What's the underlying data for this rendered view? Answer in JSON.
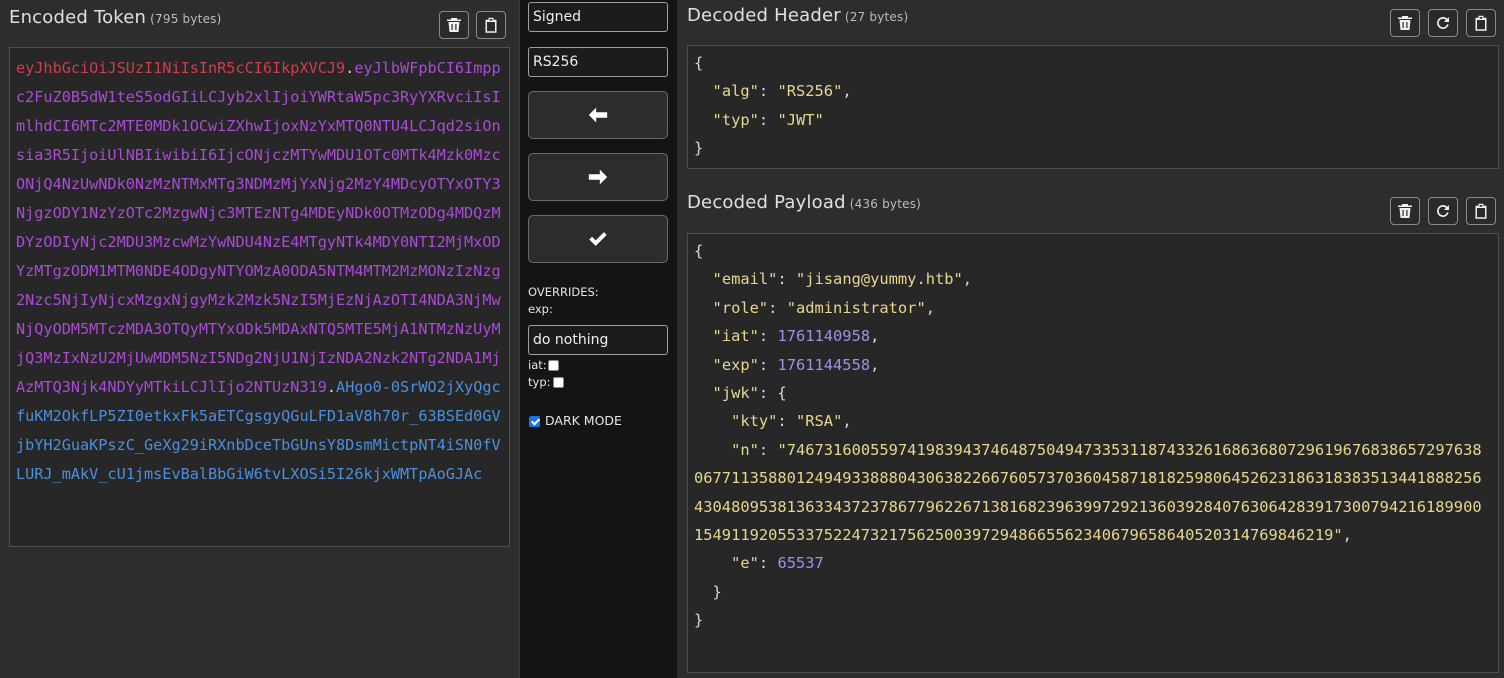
{
  "encoded": {
    "title": "Encoded Token",
    "size": "(795 bytes)",
    "header": "eyJhbGciOiJSUzI1NiIsInR5cCI6IkpXVCJ9",
    "payload": "eyJlbWFpbCI6Imppc2FuZ0B5dW1teS5odGIiLCJyb2xlIjoiYWRtaW5pc3RyYXRvciIsImlhdCI6MTc2MTE0MDk1OCwiZXhwIjoxNzYxMTQ0NTU4LCJqd2siOnsia3R5IjoiUlNBIiwibiI6IjcONjczMTYwMDU1OTc0MTk4Mzk0MzcONjQ4NzUwNDk0NzMzNTMxMTg3NDMzMjYxNjg2MzY4MDcyOTYxOTY3NjgzODY1NzYzOTc2MzgwNjc3MTEzNTg4MDEyNDk0OTMzODg4MDQzMDYzODIyNjc2MDU3MzcwMzYwNDU4NzE4MTgyNTk4MDY0NTI2MjMxODYzMTgzODM1MTM0NDE4ODgyNTYOMzA0ODA5NTM4MTM2MzMONzIzNzg2Nzc5NjIyNjcxMzgxNjgyMzk2Mzk5NzI5MjEzNjAzOTI4NDA3NjMwNjQyODM5MTczMDA3OTQyMTYxODk5MDAxNTQ5MTE5MjA1NTMzNzUyMjQ3MzIxNzU2MjUwMDM5NzI5NDg2NjU1NjIzNDA2Nzk2NTg2NDA1MjAzMTQ3Njk4NDYyMTkiLCJlIjo2NTUzN319",
    "signature": "AHgo0-0SrWO2jXyQgcfuKM2OkfLP5ZI0etkxFk5aETCgsgyQGuLFD1aV8h70r_63BSEd0GVjbYH2GuaKPszC_GeXg29iRXnbDceTbGUnsY8DsmMictpNT4iSN0fVLURJ_mAkV_cU1jmsEvBalBbGiW6tvLXOSi5I26kjxWMTpAoGJAc"
  },
  "middle": {
    "signed_value": "Signed",
    "alg_value": "RS256",
    "overrides_label": "OVERRIDES:",
    "exp_label": "exp:",
    "exp_value": "do nothing",
    "iat_label": "iat:",
    "typ_label": "typ:",
    "dark_mode_label": "DARK MODE"
  },
  "header": {
    "title": "Decoded Header",
    "size": "(27 bytes)",
    "alg": "RS256",
    "typ": "JWT"
  },
  "payload": {
    "title": "Decoded Payload",
    "size": "(436 bytes)",
    "email": "jisang@yummy.htb",
    "role": "administrator",
    "iat": "1761140958",
    "exp": "1761144558",
    "kty": "RSA",
    "n": "74673160055974198394374648750494733531187433261686368072961967683865729763806771135880124949338880430638226676057370360458718182598064526231863183835134418882564304809538136334372378677962267138168239639972921360392840763064283917300794216189900154911920553375224732175625003972948665562340679658640520314769846219",
    "e": "65537"
  },
  "icons": {
    "trash": "trash-icon",
    "clipboard": "clipboard-icon",
    "refresh": "refresh-icon",
    "arrow_left": "arrow-left-icon",
    "arrow_right": "arrow-right-icon",
    "check": "check-icon"
  },
  "colors": {
    "token_header": "#d23c4b",
    "token_payload": "#a94bd6",
    "token_signature": "#4a8fe0",
    "json_string": "#e8d68f",
    "json_number": "#a98ce6"
  }
}
